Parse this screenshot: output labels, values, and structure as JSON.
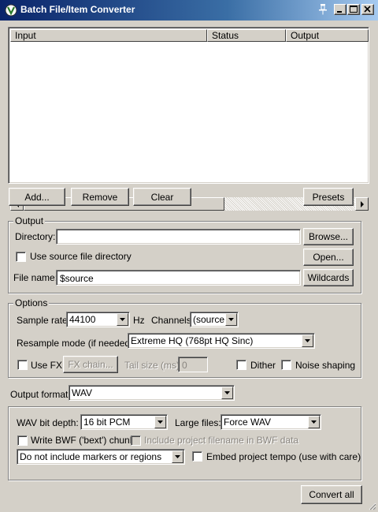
{
  "window": {
    "title": "Batch File/Item Converter"
  },
  "list": {
    "columns": [
      "Input",
      "Status",
      "Output"
    ]
  },
  "list_buttons": {
    "add": "Add...",
    "remove": "Remove",
    "clear": "Clear",
    "presets": "Presets"
  },
  "output_group": {
    "title": "Output",
    "directory_label": "Directory:",
    "directory_value": "",
    "browse": "Browse...",
    "use_source_label": "Use source file directory",
    "open": "Open...",
    "filename_label": "File name:",
    "filename_value": "$source",
    "wildcards": "Wildcards"
  },
  "options_group": {
    "title": "Options",
    "sample_rate_label": "Sample rate:",
    "sample_rate_value": "44100",
    "hz_label": "Hz",
    "channels_label": "Channels:",
    "channels_value": "(source)",
    "resample_label": "Resample mode (if needed):",
    "resample_value": "Extreme HQ (768pt HQ Sinc)",
    "use_fx_label": "Use FX",
    "fx_chain": "FX chain...",
    "tail_size_label": "Tail size (ms):",
    "tail_size_value": "0",
    "dither_label": "Dither",
    "noise_shaping_label": "Noise shaping"
  },
  "format": {
    "label": "Output format:",
    "value": "WAV"
  },
  "wav_group": {
    "bit_depth_label": "WAV bit depth:",
    "bit_depth_value": "16 bit PCM",
    "large_files_label": "Large files:",
    "large_files_value": "Force WAV",
    "bwf_label": "Write BWF ('bext') chunk",
    "include_filename_label": "Include project filename in BWF data",
    "markers_value": "Do not include markers or regions",
    "embed_tempo_label": "Embed project tempo (use with care)"
  },
  "convert_all": "Convert all"
}
